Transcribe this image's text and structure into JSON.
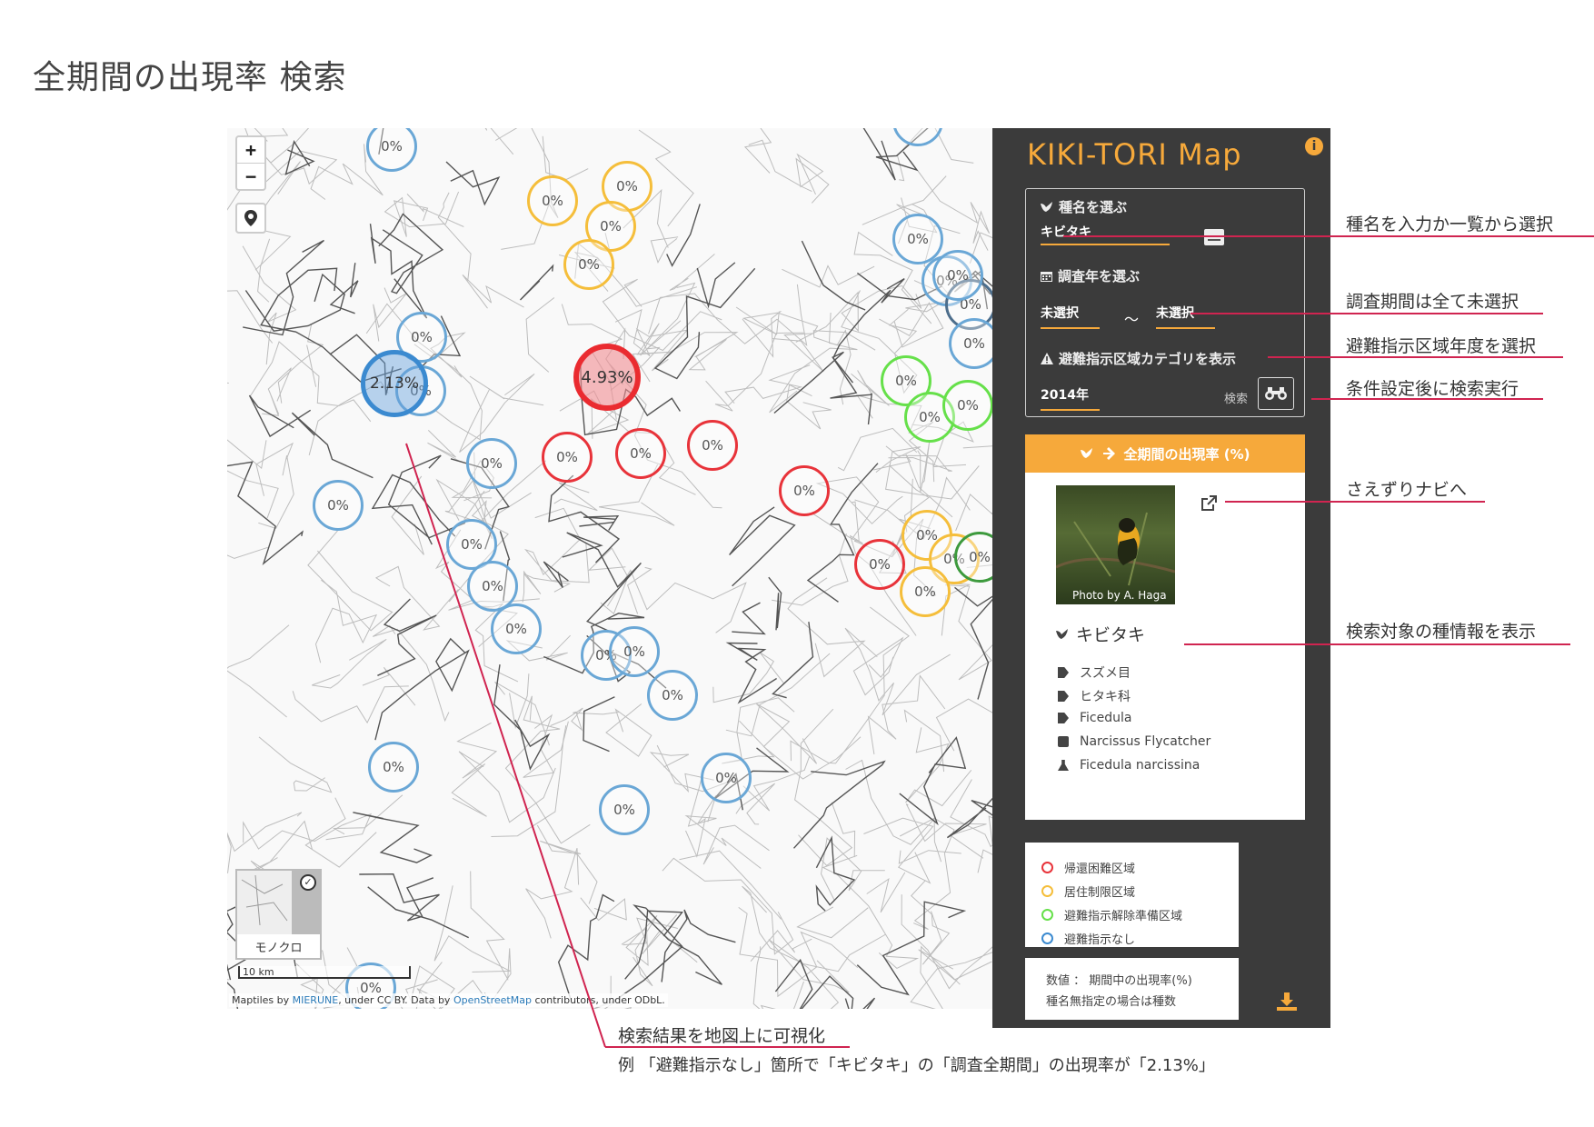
{
  "page_title": "全期間の出現率 検索",
  "map": {
    "zoom_in": "+",
    "zoom_out": "−",
    "minimap_label": "モノクロ",
    "scale_label": "10 km",
    "attribution": {
      "prefix": "Maptiles by ",
      "mierune": "MIERUNE",
      "mid": ", under CC BY. Data by ",
      "osm": "OpenStreetMap",
      "suffix": " contributors, under ODbL."
    },
    "markers": [
      {
        "label": "0%",
        "type": "blue"
      },
      {
        "label": "0%",
        "type": "blue"
      },
      {
        "label": "0%",
        "type": "blue"
      },
      {
        "label": "0%",
        "type": "blue"
      },
      {
        "label": "0%",
        "type": "yellow"
      },
      {
        "label": "0%",
        "type": "yellow"
      },
      {
        "label": "0%",
        "type": "yellow"
      },
      {
        "label": "0%",
        "type": "yellow"
      },
      {
        "label": "0%",
        "type": "blue"
      },
      {
        "label": "0%",
        "type": "blue"
      },
      {
        "label": "0%",
        "type": "blue"
      },
      {
        "label": "0%",
        "type": "blue"
      },
      {
        "label": "0%",
        "type": "blue"
      },
      {
        "label": "2.13%",
        "type": "big-blue"
      },
      {
        "label": "4.93%",
        "type": "big-red"
      },
      {
        "label": "0%",
        "type": "red"
      },
      {
        "label": "0%",
        "type": "red"
      },
      {
        "label": "0%",
        "type": "red"
      },
      {
        "label": "0%",
        "type": "red"
      },
      {
        "label": "0%",
        "type": "red"
      },
      {
        "label": "0%",
        "type": "blue"
      },
      {
        "label": "0%",
        "type": "blue"
      },
      {
        "label": "0%",
        "type": "blue"
      },
      {
        "label": "0%",
        "type": "blue"
      },
      {
        "label": "0%",
        "type": "blue"
      },
      {
        "label": "0%",
        "type": "blue"
      },
      {
        "label": "0%",
        "type": "blue"
      },
      {
        "label": "0%",
        "type": "blue"
      },
      {
        "label": "0%",
        "type": "blue"
      },
      {
        "label": "0%",
        "type": "navy"
      },
      {
        "label": "0%",
        "type": "blue"
      },
      {
        "label": "0%",
        "type": "green"
      },
      {
        "label": "0%",
        "type": "green"
      },
      {
        "label": "0%",
        "type": "green"
      },
      {
        "label": "0%",
        "type": "yellow"
      },
      {
        "label": "0%",
        "type": "yellow"
      },
      {
        "label": "0%",
        "type": "yellow"
      },
      {
        "label": "0%",
        "type": "dgreen"
      },
      {
        "label": "0%",
        "type": "blue"
      }
    ]
  },
  "panel": {
    "app_title": "KIKI-TORI  Map",
    "species_label": "種名を選ぶ",
    "species_value": "キビタキ",
    "year_label": "調査年を選ぶ",
    "year_from": "未選択",
    "year_tilde": "〜",
    "year_to": "未選択",
    "zone_label": "避難指示区域カテゴリを表示",
    "zone_value": "2014年",
    "search_label": "検索",
    "rate_header": "全期間の出現率 (%)",
    "photo_credit": "Photo by A. Haga",
    "species_name": "キビタキ",
    "taxonomy": [
      {
        "icon": "tag-icon",
        "value": "スズメ目"
      },
      {
        "icon": "tag-icon",
        "value": "ヒタキ科"
      },
      {
        "icon": "tag-icon",
        "value": "Ficedula"
      },
      {
        "icon": "translate-icon",
        "value": "Narcissus  Flycatcher"
      },
      {
        "icon": "flask-icon",
        "value": "Ficedula  narcissina"
      }
    ],
    "legend": [
      {
        "label": "帰還困難区域",
        "color": "#e8333a"
      },
      {
        "label": "居住制限区域",
        "color": "#f5be3b"
      },
      {
        "label": "避難指示解除準備区域",
        "color": "#66e04a"
      },
      {
        "label": "避難指示なし",
        "color": "#3b8ad0"
      }
    ],
    "note_line1": "数値 ： 期間中の出現率(%)",
    "note_line2": "種名無指定の場合は種数"
  },
  "annotations": {
    "a1": "種名を入力か一覧から選択",
    "a2": "調査期間は全て未選択",
    "a3": "避難指示区域年度を選択",
    "a4": "条件設定後に検索実行",
    "a5": "さえずりナビへ",
    "a6": "検索対象の種情報を表示",
    "bottom_title": "検索結果を地図上に可視化",
    "bottom_example": "例 「避難指示なし」箇所で「キビタキ」の「調査全期間」の出現率が「2.13%」"
  },
  "colors": {
    "accent": "#f6a93b",
    "panel_bg": "#3b3b3b",
    "callout": "#d02450"
  }
}
